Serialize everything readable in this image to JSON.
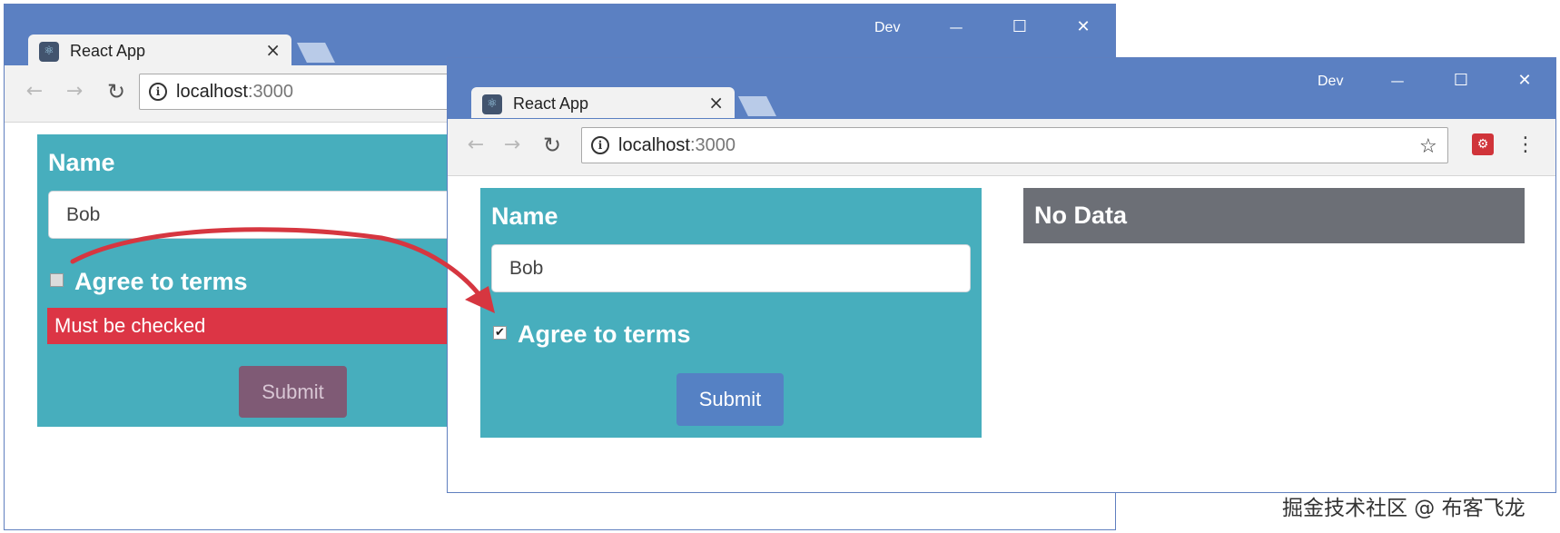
{
  "accent_colors": {
    "titlebar": "#5b80c2",
    "form_panel": "#47aebd",
    "error": "#dc3545",
    "submit_disabled": "#7f5a75",
    "submit_enabled": "#5581c4",
    "no_data": "#6c6f76",
    "annotation_arrow": "#d63640"
  },
  "back_window": {
    "profile": "Dev",
    "tab_title": "React App",
    "tab_close": "×",
    "url_host": "localhost",
    "url_port": ":3000",
    "form": {
      "name_label": "Name",
      "name_value": "Bob",
      "agree_label": "Agree to terms",
      "agree_checked": false,
      "error": "Must be checked",
      "submit_label": "Submit",
      "submit_state": "disabled"
    }
  },
  "front_window": {
    "profile": "Dev",
    "tab_title": "React App",
    "tab_close": "×",
    "url_host": "localhost",
    "url_port": ":3000",
    "form": {
      "name_label": "Name",
      "name_value": "Bob",
      "agree_label": "Agree to terms",
      "agree_checked": true,
      "submit_label": "Submit",
      "submit_state": "enabled"
    },
    "result_panel": "No Data"
  },
  "icons": {
    "back": "←",
    "forward": "→",
    "reload": "↻",
    "info": "i",
    "star": "☆",
    "menu": "⋮",
    "minimize": "—",
    "maximize": "☐",
    "close": "✕",
    "check": "✔"
  },
  "watermark": "掘金技术社区 @ 布客飞龙"
}
